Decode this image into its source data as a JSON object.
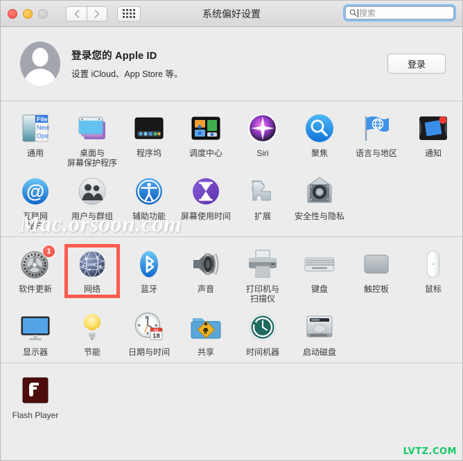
{
  "window": {
    "title": "系统偏好设置",
    "traffic_lights": [
      "close",
      "minimize",
      "zoom"
    ],
    "nav": {
      "back": "‹",
      "forward": "›",
      "grid": "grid-view"
    }
  },
  "search": {
    "placeholder": "搜索",
    "value": "",
    "icon": "search-icon",
    "focused": true
  },
  "apple_id": {
    "title": "登录您的 Apple ID",
    "subtitle": "设置 iCloud、App Store 等。",
    "button": "登录",
    "avatar": "default-user-avatar"
  },
  "sections": [
    {
      "name": "personal",
      "rows": [
        [
          {
            "label": "通用",
            "icon": "general-icon"
          },
          {
            "label": "桌面与\n屏幕保护程序",
            "icon": "desktop-screensaver-icon"
          },
          {
            "label": "程序坞",
            "icon": "dock-icon"
          },
          {
            "label": "调度中心",
            "icon": "mission-control-icon"
          },
          {
            "label": "Siri",
            "icon": "siri-icon"
          },
          {
            "label": "聚焦",
            "icon": "spotlight-icon"
          },
          {
            "label": "语言与地区",
            "icon": "language-region-icon"
          },
          {
            "label": "通知",
            "icon": "notifications-icon"
          }
        ],
        [
          {
            "label": "互联网\n帐户",
            "icon": "internet-accounts-icon"
          },
          {
            "label": "用户与群组",
            "icon": "users-groups-icon"
          },
          {
            "label": "辅助功能",
            "icon": "accessibility-icon"
          },
          {
            "label": "屏幕使用时间",
            "icon": "screen-time-icon"
          },
          {
            "label": "扩展",
            "icon": "extensions-icon"
          },
          {
            "label": "安全性与隐私",
            "icon": "security-privacy-icon"
          }
        ]
      ]
    },
    {
      "name": "hardware",
      "rows": [
        [
          {
            "label": "软件更新",
            "icon": "software-update-icon",
            "badge": "1"
          },
          {
            "label": "网络",
            "icon": "network-icon",
            "highlighted": true
          },
          {
            "label": "蓝牙",
            "icon": "bluetooth-icon"
          },
          {
            "label": "声音",
            "icon": "sound-icon"
          },
          {
            "label": "打印机与\n扫描仪",
            "icon": "printers-scanners-icon"
          },
          {
            "label": "键盘",
            "icon": "keyboard-icon"
          },
          {
            "label": "触控板",
            "icon": "trackpad-icon"
          },
          {
            "label": "鼠标",
            "icon": "mouse-icon"
          }
        ],
        [
          {
            "label": "显示器",
            "icon": "displays-icon"
          },
          {
            "label": "节能",
            "icon": "energy-saver-icon"
          },
          {
            "label": "日期与时间",
            "icon": "date-time-icon",
            "calendar_month": "JUL",
            "calendar_day": "18"
          },
          {
            "label": "共享",
            "icon": "sharing-icon"
          },
          {
            "label": "时间机器",
            "icon": "time-machine-icon"
          },
          {
            "label": "启动磁盘",
            "icon": "startup-disk-icon"
          }
        ]
      ]
    },
    {
      "name": "third-party",
      "rows": [
        [
          {
            "label": "Flash Player",
            "icon": "flash-player-icon"
          }
        ]
      ]
    }
  ],
  "watermarks": {
    "main": "Mac.orsoon.com",
    "corner": "LVTZ.COM"
  },
  "colors": {
    "highlight": "#fb5b4e",
    "badge": "#e8433a",
    "focus_ring": "#89bdf0",
    "corner_watermark": "#17c964"
  }
}
